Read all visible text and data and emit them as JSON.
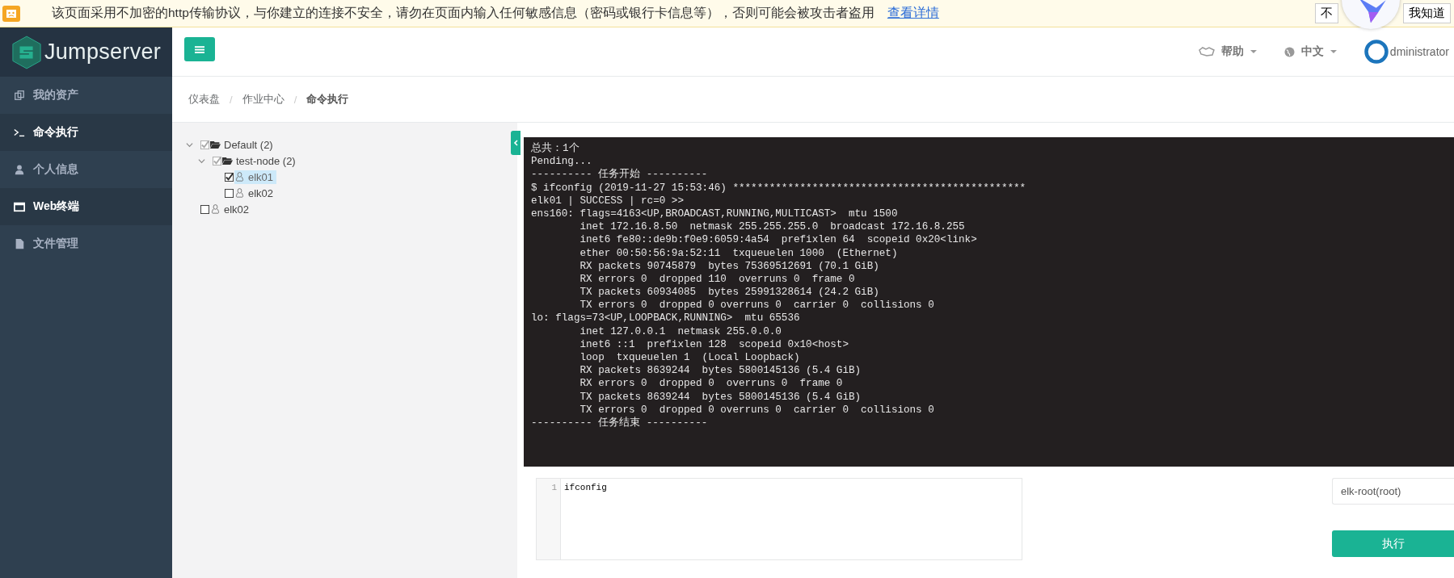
{
  "security_warning": {
    "message": "该页面采用不加密的http传输协议，与你建立的连接不安全，请勿在页面内输入任何敏感信息（密码或银行卡信息等），否则可能会被攻击者盗用",
    "link": "查看详情",
    "buttons": [
      "不",
      "我知道"
    ]
  },
  "sidebar": {
    "logo": "Jumpserver",
    "items": [
      {
        "label": "我的资产",
        "selected": false
      },
      {
        "label": "命令执行",
        "selected": true
      },
      {
        "label": "个人信息",
        "selected": false
      },
      {
        "label": "Web终端",
        "selected": true
      },
      {
        "label": "文件管理",
        "selected": false
      }
    ]
  },
  "header": {
    "help": "帮助",
    "language": "中文",
    "user": "dministrator"
  },
  "breadcrumb": {
    "items": [
      "仪表盘",
      "作业中心",
      "命令执行"
    ],
    "separators": [
      "/",
      "/"
    ]
  },
  "tree": [
    {
      "label": "Default (2)",
      "kind": "node",
      "expanded": true,
      "checked": true,
      "partial": true,
      "selected": false,
      "children": [
        {
          "label": "test-node (2)",
          "kind": "node",
          "expanded": true,
          "checked": true,
          "partial": true,
          "selected": false,
          "children": [
            {
              "label": "elk01",
              "kind": "host",
              "checked": true,
              "partial": false,
              "selected": true
            },
            {
              "label": "elk02",
              "kind": "host",
              "checked": false,
              "partial": false,
              "selected": false
            }
          ]
        }
      ]
    },
    {
      "label": "elk02",
      "kind": "host",
      "checked": false,
      "partial": false,
      "selected": false
    }
  ],
  "terminal": {
    "lines": [
      "总共：1个",
      "Pending...",
      "---------- 任务开始 ----------",
      "$ ifconfig (2019-11-27 15:53:46) ************************************************",
      "elk01 | SUCCESS | rc=0 >>",
      "ens160: flags=4163<UP,BROADCAST,RUNNING,MULTICAST>  mtu 1500",
      "        inet 172.16.8.50  netmask 255.255.255.0  broadcast 172.16.8.255",
      "        inet6 fe80::de9b:f0e9:6059:4a54  prefixlen 64  scopeid 0x20<link>",
      "        ether 00:50:56:9a:52:11  txqueuelen 1000  (Ethernet)",
      "        RX packets 90745879  bytes 75369512691 (70.1 GiB)",
      "        RX errors 0  dropped 110  overruns 0  frame 0",
      "        TX packets 60934085  bytes 25991328614 (24.2 GiB)",
      "        TX errors 0  dropped 0 overruns 0  carrier 0  collisions 0",
      "lo: flags=73<UP,LOOPBACK,RUNNING>  mtu 65536",
      "        inet 127.0.0.1  netmask 255.0.0.0",
      "        inet6 ::1  prefixlen 128  scopeid 0x10<host>",
      "        loop  txqueuelen 1  (Local Loopback)",
      "        RX packets 8639244  bytes 5800145136 (5.4 GiB)",
      "        RX errors 0  dropped 0  overruns 0  frame 0",
      "        TX packets 8639244  bytes 5800145136 (5.4 GiB)",
      "        TX errors 0  dropped 0 overruns 0  carrier 0  collisions 0",
      "---------- 任务结束 ----------"
    ]
  },
  "editor": {
    "line_numbers": [
      "1"
    ],
    "code": "ifconfig"
  },
  "run_as": {
    "value": "elk-root(root)"
  },
  "run_button": "执行"
}
